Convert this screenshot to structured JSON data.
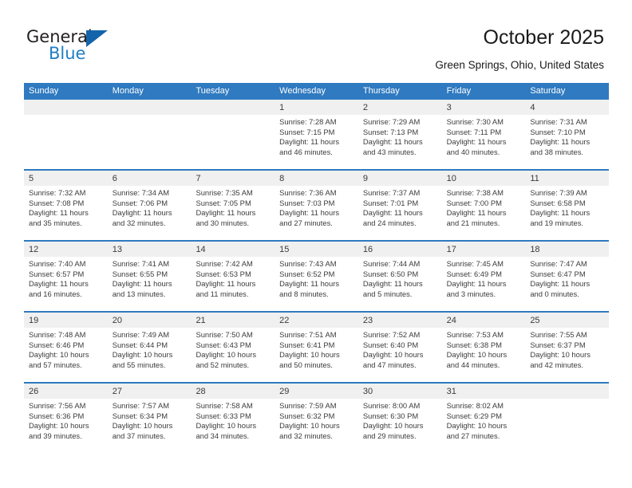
{
  "brand": {
    "name_part1": "General",
    "name_part2": "Blue",
    "logo_icon": "triangle-logo-icon",
    "accent_color": "#1464aa",
    "text_color": "#1f7ec4"
  },
  "header": {
    "title": "October 2025",
    "subtitle": "Green Springs, Ohio, United States"
  },
  "calendar": {
    "header_bg": "#2f7ac0",
    "day_band_bg": "#f0f0f0",
    "weekday_headers": [
      "Sunday",
      "Monday",
      "Tuesday",
      "Wednesday",
      "Thursday",
      "Friday",
      "Saturday"
    ],
    "weeks": [
      [
        {
          "day": "",
          "sunrise": "",
          "sunset": "",
          "daylight_line1": "",
          "daylight_line2": ""
        },
        {
          "day": "",
          "sunrise": "",
          "sunset": "",
          "daylight_line1": "",
          "daylight_line2": ""
        },
        {
          "day": "",
          "sunrise": "",
          "sunset": "",
          "daylight_line1": "",
          "daylight_line2": ""
        },
        {
          "day": "1",
          "sunrise": "Sunrise: 7:28 AM",
          "sunset": "Sunset: 7:15 PM",
          "daylight_line1": "Daylight: 11 hours",
          "daylight_line2": "and 46 minutes."
        },
        {
          "day": "2",
          "sunrise": "Sunrise: 7:29 AM",
          "sunset": "Sunset: 7:13 PM",
          "daylight_line1": "Daylight: 11 hours",
          "daylight_line2": "and 43 minutes."
        },
        {
          "day": "3",
          "sunrise": "Sunrise: 7:30 AM",
          "sunset": "Sunset: 7:11 PM",
          "daylight_line1": "Daylight: 11 hours",
          "daylight_line2": "and 40 minutes."
        },
        {
          "day": "4",
          "sunrise": "Sunrise: 7:31 AM",
          "sunset": "Sunset: 7:10 PM",
          "daylight_line1": "Daylight: 11 hours",
          "daylight_line2": "and 38 minutes."
        }
      ],
      [
        {
          "day": "5",
          "sunrise": "Sunrise: 7:32 AM",
          "sunset": "Sunset: 7:08 PM",
          "daylight_line1": "Daylight: 11 hours",
          "daylight_line2": "and 35 minutes."
        },
        {
          "day": "6",
          "sunrise": "Sunrise: 7:34 AM",
          "sunset": "Sunset: 7:06 PM",
          "daylight_line1": "Daylight: 11 hours",
          "daylight_line2": "and 32 minutes."
        },
        {
          "day": "7",
          "sunrise": "Sunrise: 7:35 AM",
          "sunset": "Sunset: 7:05 PM",
          "daylight_line1": "Daylight: 11 hours",
          "daylight_line2": "and 30 minutes."
        },
        {
          "day": "8",
          "sunrise": "Sunrise: 7:36 AM",
          "sunset": "Sunset: 7:03 PM",
          "daylight_line1": "Daylight: 11 hours",
          "daylight_line2": "and 27 minutes."
        },
        {
          "day": "9",
          "sunrise": "Sunrise: 7:37 AM",
          "sunset": "Sunset: 7:01 PM",
          "daylight_line1": "Daylight: 11 hours",
          "daylight_line2": "and 24 minutes."
        },
        {
          "day": "10",
          "sunrise": "Sunrise: 7:38 AM",
          "sunset": "Sunset: 7:00 PM",
          "daylight_line1": "Daylight: 11 hours",
          "daylight_line2": "and 21 minutes."
        },
        {
          "day": "11",
          "sunrise": "Sunrise: 7:39 AM",
          "sunset": "Sunset: 6:58 PM",
          "daylight_line1": "Daylight: 11 hours",
          "daylight_line2": "and 19 minutes."
        }
      ],
      [
        {
          "day": "12",
          "sunrise": "Sunrise: 7:40 AM",
          "sunset": "Sunset: 6:57 PM",
          "daylight_line1": "Daylight: 11 hours",
          "daylight_line2": "and 16 minutes."
        },
        {
          "day": "13",
          "sunrise": "Sunrise: 7:41 AM",
          "sunset": "Sunset: 6:55 PM",
          "daylight_line1": "Daylight: 11 hours",
          "daylight_line2": "and 13 minutes."
        },
        {
          "day": "14",
          "sunrise": "Sunrise: 7:42 AM",
          "sunset": "Sunset: 6:53 PM",
          "daylight_line1": "Daylight: 11 hours",
          "daylight_line2": "and 11 minutes."
        },
        {
          "day": "15",
          "sunrise": "Sunrise: 7:43 AM",
          "sunset": "Sunset: 6:52 PM",
          "daylight_line1": "Daylight: 11 hours",
          "daylight_line2": "and 8 minutes."
        },
        {
          "day": "16",
          "sunrise": "Sunrise: 7:44 AM",
          "sunset": "Sunset: 6:50 PM",
          "daylight_line1": "Daylight: 11 hours",
          "daylight_line2": "and 5 minutes."
        },
        {
          "day": "17",
          "sunrise": "Sunrise: 7:45 AM",
          "sunset": "Sunset: 6:49 PM",
          "daylight_line1": "Daylight: 11 hours",
          "daylight_line2": "and 3 minutes."
        },
        {
          "day": "18",
          "sunrise": "Sunrise: 7:47 AM",
          "sunset": "Sunset: 6:47 PM",
          "daylight_line1": "Daylight: 11 hours",
          "daylight_line2": "and 0 minutes."
        }
      ],
      [
        {
          "day": "19",
          "sunrise": "Sunrise: 7:48 AM",
          "sunset": "Sunset: 6:46 PM",
          "daylight_line1": "Daylight: 10 hours",
          "daylight_line2": "and 57 minutes."
        },
        {
          "day": "20",
          "sunrise": "Sunrise: 7:49 AM",
          "sunset": "Sunset: 6:44 PM",
          "daylight_line1": "Daylight: 10 hours",
          "daylight_line2": "and 55 minutes."
        },
        {
          "day": "21",
          "sunrise": "Sunrise: 7:50 AM",
          "sunset": "Sunset: 6:43 PM",
          "daylight_line1": "Daylight: 10 hours",
          "daylight_line2": "and 52 minutes."
        },
        {
          "day": "22",
          "sunrise": "Sunrise: 7:51 AM",
          "sunset": "Sunset: 6:41 PM",
          "daylight_line1": "Daylight: 10 hours",
          "daylight_line2": "and 50 minutes."
        },
        {
          "day": "23",
          "sunrise": "Sunrise: 7:52 AM",
          "sunset": "Sunset: 6:40 PM",
          "daylight_line1": "Daylight: 10 hours",
          "daylight_line2": "and 47 minutes."
        },
        {
          "day": "24",
          "sunrise": "Sunrise: 7:53 AM",
          "sunset": "Sunset: 6:38 PM",
          "daylight_line1": "Daylight: 10 hours",
          "daylight_line2": "and 44 minutes."
        },
        {
          "day": "25",
          "sunrise": "Sunrise: 7:55 AM",
          "sunset": "Sunset: 6:37 PM",
          "daylight_line1": "Daylight: 10 hours",
          "daylight_line2": "and 42 minutes."
        }
      ],
      [
        {
          "day": "26",
          "sunrise": "Sunrise: 7:56 AM",
          "sunset": "Sunset: 6:36 PM",
          "daylight_line1": "Daylight: 10 hours",
          "daylight_line2": "and 39 minutes."
        },
        {
          "day": "27",
          "sunrise": "Sunrise: 7:57 AM",
          "sunset": "Sunset: 6:34 PM",
          "daylight_line1": "Daylight: 10 hours",
          "daylight_line2": "and 37 minutes."
        },
        {
          "day": "28",
          "sunrise": "Sunrise: 7:58 AM",
          "sunset": "Sunset: 6:33 PM",
          "daylight_line1": "Daylight: 10 hours",
          "daylight_line2": "and 34 minutes."
        },
        {
          "day": "29",
          "sunrise": "Sunrise: 7:59 AM",
          "sunset": "Sunset: 6:32 PM",
          "daylight_line1": "Daylight: 10 hours",
          "daylight_line2": "and 32 minutes."
        },
        {
          "day": "30",
          "sunrise": "Sunrise: 8:00 AM",
          "sunset": "Sunset: 6:30 PM",
          "daylight_line1": "Daylight: 10 hours",
          "daylight_line2": "and 29 minutes."
        },
        {
          "day": "31",
          "sunrise": "Sunrise: 8:02 AM",
          "sunset": "Sunset: 6:29 PM",
          "daylight_line1": "Daylight: 10 hours",
          "daylight_line2": "and 27 minutes."
        },
        {
          "day": "",
          "sunrise": "",
          "sunset": "",
          "daylight_line1": "",
          "daylight_line2": ""
        }
      ]
    ]
  }
}
